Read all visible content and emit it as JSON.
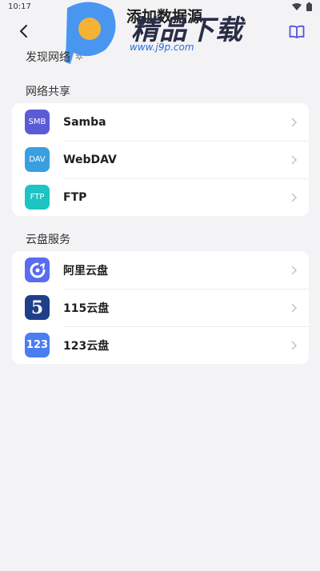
{
  "status_bar": {
    "time": "10:17"
  },
  "header": {
    "title": "添加数据源"
  },
  "watermark": {
    "brand": "精品下载",
    "url": "www.j9p.com"
  },
  "discover": {
    "label": "发现网络"
  },
  "sections": [
    {
      "label": "网络共享",
      "items": [
        {
          "label": "Samba",
          "icon_text": "SMB",
          "icon_color": "#5b5bd6",
          "icon": "smb-icon"
        },
        {
          "label": "WebDAV",
          "icon_text": "DAV",
          "icon_color": "#3a9fe0",
          "icon": "dav-icon"
        },
        {
          "label": "FTP",
          "icon_text": "FTP",
          "icon_color": "#1cc4c4",
          "icon": "ftp-icon"
        }
      ]
    },
    {
      "label": "云盘服务",
      "items": [
        {
          "label": "阿里云盘",
          "icon": "aliyun-icon",
          "icon_color": "#5a6cf0"
        },
        {
          "label": "115云盘",
          "icon": "115-icon",
          "icon_text": "5",
          "icon_color": "#1f3f8a"
        },
        {
          "label": "123云盘",
          "icon": "123-icon",
          "icon_text": "123",
          "icon_color": "#4a7df0"
        }
      ]
    }
  ],
  "colors": {
    "accent": "#5b4fd6",
    "background": "#f3f3f5",
    "card": "#ffffff"
  }
}
